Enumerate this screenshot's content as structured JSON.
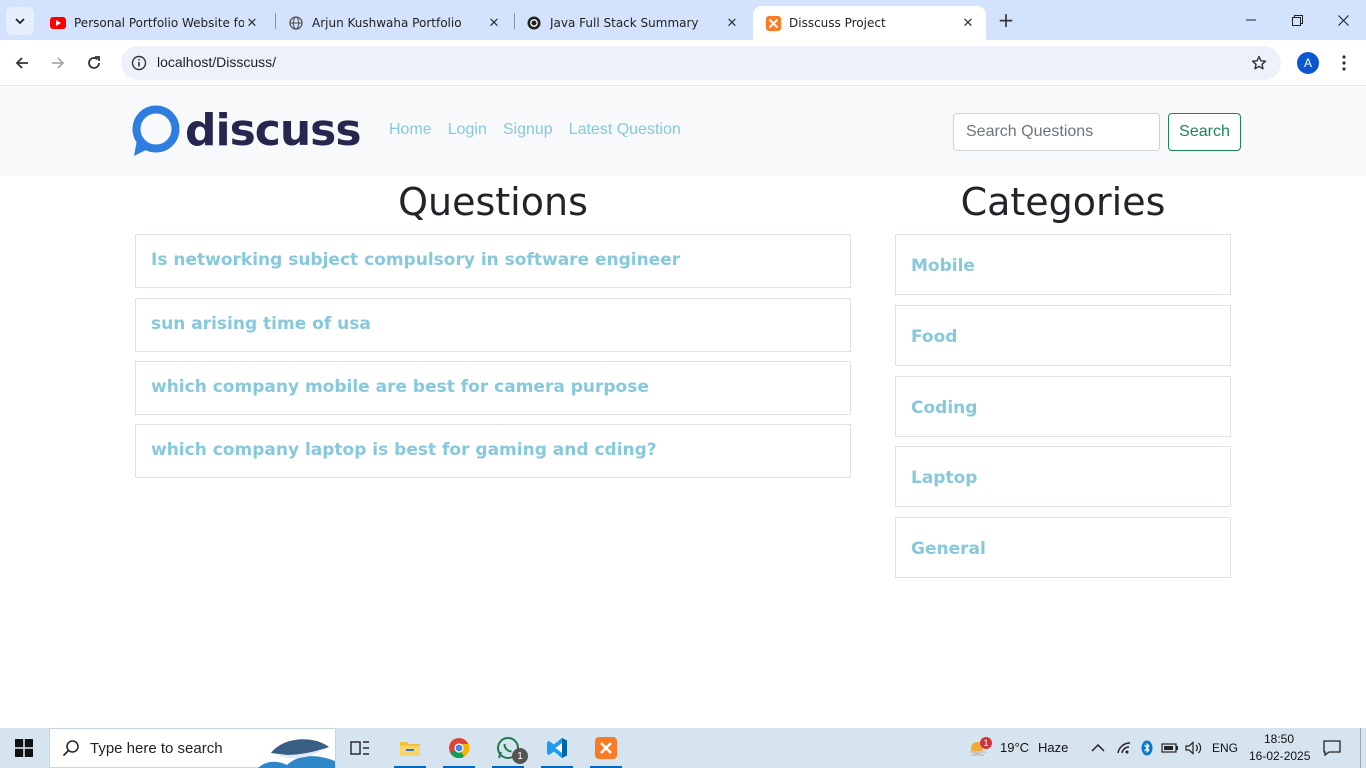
{
  "browser": {
    "tabs": [
      {
        "title": "Personal Portfolio Website for B",
        "favicon": "youtube-icon",
        "active": false
      },
      {
        "title": "Arjun Kushwaha Portfolio",
        "favicon": "globe-icon",
        "active": false
      },
      {
        "title": "Java Full Stack Summary",
        "favicon": "chatgpt-icon",
        "active": false
      },
      {
        "title": "Disscuss Project",
        "favicon": "xampp-icon",
        "active": true
      }
    ],
    "url": "localhost/Disscuss/",
    "profile_initial": "A"
  },
  "site": {
    "logo_text": "discuss",
    "nav": [
      "Home",
      "Login",
      "Signup",
      "Latest Question"
    ],
    "search_placeholder": "Search Questions",
    "search_button": "Search"
  },
  "questions": {
    "title": "Questions",
    "items": [
      "Is networking subject compulsory in software engineer",
      "sun arising time of usa",
      "which company mobile are best for camera purpose",
      "which company laptop is best for gaming and cding?"
    ]
  },
  "categories": {
    "title": "Categories",
    "items": [
      "Mobile",
      "Food",
      "Coding",
      "Laptop",
      "General"
    ]
  },
  "taskbar": {
    "search_placeholder": "Type here to search",
    "weather_temp": "19°C",
    "weather_desc": "Haze",
    "weather_badge": "1",
    "language": "ENG",
    "time": "18:50",
    "date": "16-02-2025",
    "whatsapp_badge": "1"
  },
  "colors": {
    "tab_strip": "#d3e3fd",
    "link": "#86c8dc",
    "logo_blue": "#2f7de1",
    "logo_text": "#27264f",
    "search_button": "#198754"
  }
}
